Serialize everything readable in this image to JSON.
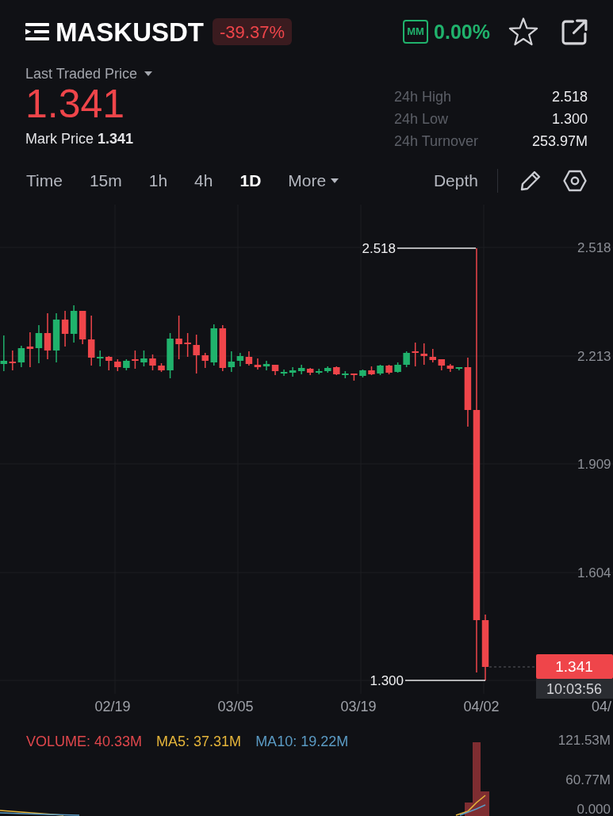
{
  "header": {
    "symbol": "MASKUSDT",
    "change": "-39.37%",
    "mm_label": "MM",
    "mm_value": "0.00%",
    "favorited": false
  },
  "price": {
    "label": "Last Traded Price",
    "last": "1.341",
    "mark": "Mark Price **1.341**"
  },
  "stats": [
    {
      "label": "24h High",
      "value": "2.518"
    },
    {
      "label": "24h Low",
      "value": "1.300"
    },
    {
      "label": "24h Turnover",
      "value": "253.97M"
    }
  ],
  "intervals": [
    {
      "label": "Time",
      "kind": "option",
      "selected": false
    },
    {
      "label": "15m",
      "kind": "option",
      "selected": false
    },
    {
      "label": "1h",
      "kind": "option",
      "selected": false
    },
    {
      "label": "4h",
      "kind": "option",
      "selected": false
    },
    {
      "label": "1D",
      "kind": "option",
      "selected": true
    },
    {
      "label": "More",
      "kind": "dropdown",
      "selected": false
    }
  ],
  "depth": "Depth",
  "chart": {
    "price_axis": [
      "2.518",
      "2.213",
      "1.909",
      "1.604"
    ],
    "date_axis": [
      "02/19",
      "03/05",
      "03/19",
      "04/02",
      "04/"
    ],
    "high_label": "2.518",
    "low_label": "1.300",
    "last_price": "1.341",
    "countdown": "10:03:56"
  },
  "volume": {
    "legend": [
      {
        "label": "VOLUME: 40.33M",
        "color": "#e0474c"
      },
      {
        "label": "MA5: 37.31M",
        "color": "#e5b53a"
      },
      {
        "label": "MA10: 19.22M",
        "color": "#5b9bc4"
      }
    ],
    "axis": [
      "121.53M",
      "60.77M",
      "0.000"
    ]
  }
}
